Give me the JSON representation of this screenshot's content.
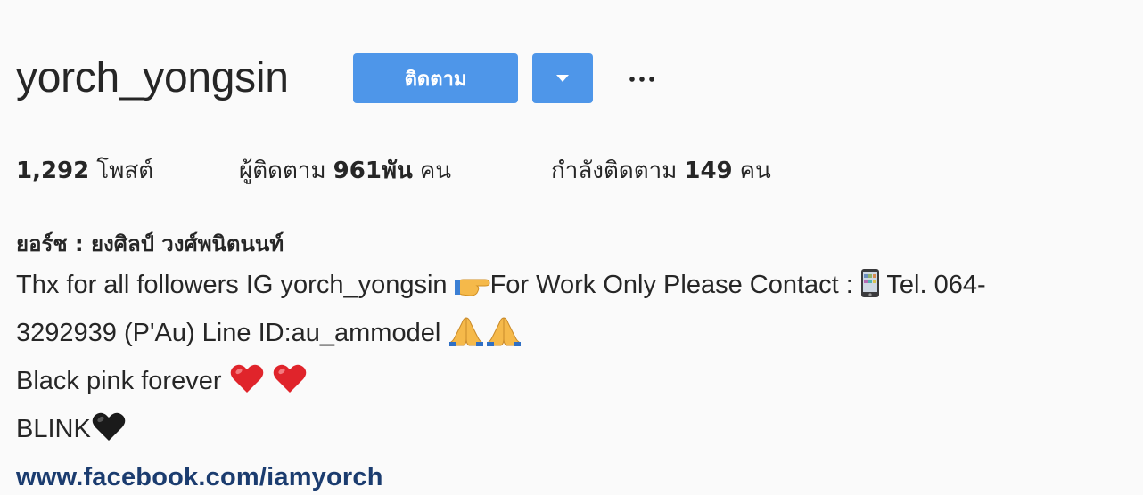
{
  "profile": {
    "username": "yorch_yongsin",
    "follow_label": "ติดตาม",
    "more_label": "···"
  },
  "stats": {
    "posts_count": "1,292",
    "posts_label": "โพสต์",
    "followers_label": "ผู้ติดตาม",
    "followers_count": "961พัน",
    "followers_unit": "คน",
    "following_label": "กำลังติดตาม",
    "following_count": "149",
    "following_unit": "คน"
  },
  "bio": {
    "full_name": "ยอร์ช : ยงศิลป์ วงศ์พนิตนนท์",
    "line1_a": "Thx for all followers IG yorch_yongsin ",
    "line1_b": "For Work Only Please Contact : ",
    "line1_c": " Tel. 064-",
    "line2": "3292939 (P'Au) Line ID:au_ammodel ",
    "line3": "Black pink forever ",
    "line4": "BLINK",
    "link": "www.facebook.com/iamyorch"
  },
  "colors": {
    "background": "#fafafa",
    "button_blue": "#4e96e9",
    "text": "#262626",
    "link": "#1b3c6f",
    "heart_red": "#e0242b"
  },
  "icons": {
    "dropdown": "caret-down-icon",
    "more": "ellipsis-icon",
    "point_right": "backhand-index-pointing-right-emoji",
    "phone": "mobile-phone-emoji",
    "pray": "folded-hands-emoji",
    "red_heart": "red-heart-emoji",
    "black_heart": "black-heart-emoji"
  }
}
